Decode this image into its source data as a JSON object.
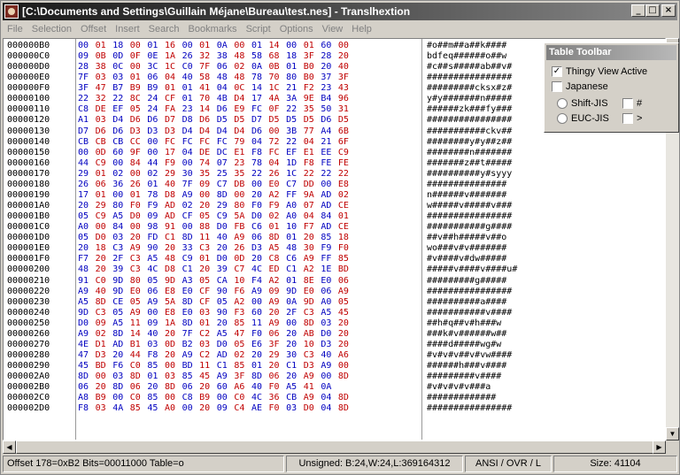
{
  "window": {
    "title": "[C:\\Documents and Settings\\Guillain Méjane\\Bureau\\test.nes] - Translhextion",
    "minimize": "_",
    "maximize": "□",
    "close": "×"
  },
  "menu": [
    "File",
    "Selection",
    "Offset",
    "Insert",
    "Search",
    "Bookmarks",
    "Script",
    "Options",
    "View",
    "Help"
  ],
  "rows": [
    {
      "addr": "000000B0",
      "hex": "00 01 18 00 01 16 00 01 0A 00 01 14 00 01 60 00",
      "ascii": "#o##m##a##k####"
    },
    {
      "addr": "000000C0",
      "hex": "09 0B 0D 0F 0E 1A 26 32 38 48 58 68 18 3F 28 20",
      "ascii": "bdfeq######o##w"
    },
    {
      "addr": "000000D0",
      "hex": "28 38 0C 00 3C 1C C0 7F 06 02 0A 0B 01 B0 20 40",
      "ascii": "#c##s#####ab##v#"
    },
    {
      "addr": "000000E0",
      "hex": "7F 03 03 01 06 04 40 58 48 48 78 70 80 B0 37 3F",
      "ascii": "################"
    },
    {
      "addr": "000000F0",
      "hex": "3F 47 B7 B9 B9 01 01 41 04 0C 14 1C 21 F2 23 43",
      "ascii": "#########cksx#z#"
    },
    {
      "addr": "00000100",
      "hex": "22 32 22 8C 24 CF 01 70 4B D4 17 4A 3A 9E B4 96",
      "ascii": "y#y#######n#####"
    },
    {
      "addr": "00000110",
      "hex": "C8 DE EF 05 24 FA 23 14 D6 E9 FC 0F 22 35 50 31",
      "ascii": "######zk###fy###"
    },
    {
      "addr": "00000120",
      "hex": "A1 03 D4 D6 D6 D7 D8 D6 D5 D5 D7 D5 D5 D5 D6 D5",
      "ascii": "################"
    },
    {
      "addr": "00000130",
      "hex": "D7 D6 D6 D3 D3 D3 D4 D4 D4 D4 D6 00 3B 77 A4 6B",
      "ascii": "###########ckv##"
    },
    {
      "addr": "00000140",
      "hex": "CB CB CB CC 00 FC FC FC FC 79 04 72 22 04 21 6F",
      "ascii": "########y#y##z##"
    },
    {
      "addr": "00000150",
      "hex": "00 0D 60 9F 00 17 04 DE DC E1 F8 FC EF E1 EE C9",
      "ascii": "########n#######"
    },
    {
      "addr": "00000160",
      "hex": "44 C9 00 84 44 F9 00 74 07 23 78 04 1D F8 FE FE",
      "ascii": "#######z##t#####"
    },
    {
      "addr": "00000170",
      "hex": "29 01 02 00 02 29 30 35 25 35 22 26 1C 22 22 22",
      "ascii": "##########y#syyy"
    },
    {
      "addr": "00000180",
      "hex": "26 06 36 26 01 40 7F 09 C7 DB 00 E0 C7 DD 00 E8",
      "ascii": "###############"
    },
    {
      "addr": "00000190",
      "hex": "17 01 00 01 78 D8 A9 00 8D 00 20 A2 FF 9A AD 02",
      "ascii": "n######v#######"
    },
    {
      "addr": "000001A0",
      "hex": "20 29 80 F0 F9 AD 02 20 29 80 F0 F9 A0 07 AD CE",
      "ascii": "w#####v#####v###"
    },
    {
      "addr": "000001B0",
      "hex": "05 C9 A5 D0 09 AD CF 05 C9 5A D0 02 A0 04 84 01",
      "ascii": "################"
    },
    {
      "addr": "000001C0",
      "hex": "A0 00 84 00 98 91 00 88 D0 FB C6 01 10 F7 AD CE",
      "ascii": "###########g####"
    },
    {
      "addr": "000001D0",
      "hex": "05 D0 03 20 FD C1 8D 11 40 A9 06 8D 01 20 85 18",
      "ascii": "##v##h#####v##o"
    },
    {
      "addr": "000001E0",
      "hex": "20 18 C3 A9 90 20 33 C3 20 26 D3 A5 48 30 F9 F0",
      "ascii": "wo###v#v#######"
    },
    {
      "addr": "000001F0",
      "hex": "F7 20 2F C3 A5 48 C9 01 D0 0D 20 C8 C6 A9 FF 85",
      "ascii": "#v####v#dw#####"
    },
    {
      "addr": "00000200",
      "hex": "48 20 39 C3 4C D8 C1 20 39 C7 4C ED C1 A2 1E BD",
      "ascii": "#####v####v####u#"
    },
    {
      "addr": "00000210",
      "hex": "91 C0 9D 80 05 9D A3 05 CA 10 F4 A2 01 8E E0 06",
      "ascii": "#########g#####"
    },
    {
      "addr": "00000220",
      "hex": "A9 40 9D E0 06 E8 E0 CF 90 F6 A9 09 9D E0 06 A9",
      "ascii": "################"
    },
    {
      "addr": "00000230",
      "hex": "A5 8D CE 05 A9 5A 8D CF 05 A2 00 A9 0A 9D A0 05",
      "ascii": "##########a####"
    },
    {
      "addr": "00000240",
      "hex": "9D C3 05 A9 00 E8 E0 03 90 F3 60 20 2F C3 A5 45",
      "ascii": "###########v####"
    },
    {
      "addr": "00000250",
      "hex": "D0 09 A5 11 09 1A 8D 01 20 85 11 A9 00 8D 03 20",
      "ascii": "##h#q##v#h###w"
    },
    {
      "addr": "00000260",
      "hex": "A9 02 8D 14 40 20 7F C2 A5 47 F0 06 20 AB D0 20",
      "ascii": "###k#v######w##"
    },
    {
      "addr": "00000270",
      "hex": "4E D1 AD B1 03 0D B2 03 D0 05 E6 3F 20 10 D3 20",
      "ascii": "####d#####wg#w"
    },
    {
      "addr": "00000280",
      "hex": "47 D3 20 44 F8 20 A9 C2 AD 02 20 29 30 C3 40 A6",
      "ascii": "#v#v#v##v#vw####"
    },
    {
      "addr": "00000290",
      "hex": "45 BD F6 C0 85 00 BD 11 C1 85 01 20 C1 D3 A9 00",
      "ascii": "######h###v####"
    },
    {
      "addr": "000002A0",
      "hex": "8D 00 03 8D 01 03 85 45 A9 3F 8D 06 20 A9 00 8D",
      "ascii": "#########v####"
    },
    {
      "addr": "000002B0",
      "hex": "06 20 8D 06 20 8D 06 20 60 A6 40 F0 A5 41 0A",
      "ascii": "#v#v#v#v###a"
    },
    {
      "addr": "000002C0",
      "hex": "A8 B9 00 C0 85 00 C8 B9 00 C0 4C 36 CB A9 04 8D",
      "ascii": "#############"
    },
    {
      "addr": "000002D0",
      "hex": "F8 03 4A 85 45 A0 00 20 09 C4 AE F0 03 D0 04 8D",
      "ascii": "################"
    }
  ],
  "table_toolbar": {
    "title": "Table Toolbar",
    "thingy_view": "Thingy View Active",
    "japanese": "Japanese",
    "shift_jis": "Shift-JIS",
    "euc_jis": "EUC-JIS",
    "hash_label": "#",
    "gt_label": ">"
  },
  "status": {
    "offset": "Offset 178=0xB2  Bits=00011000  Table=o",
    "unsigned": "Unsigned: B:24,W:24,L:369164312",
    "mode": "ANSI / OVR / L",
    "size": "Size: 41104"
  },
  "colors": {
    "hex_blue": "#0000c0",
    "hex_red": "#c00000"
  }
}
